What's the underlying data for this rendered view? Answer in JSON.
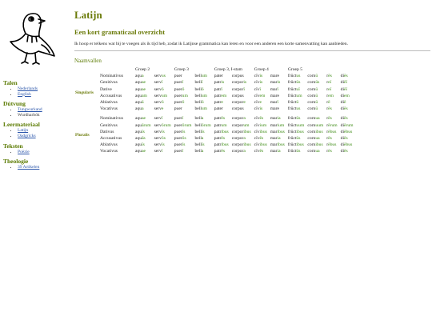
{
  "page": {
    "title": "Latijn",
    "subtitle": "Een kort gramaticaal overzicht",
    "intro": "Ik hoop er telkens wat bij te voegen als ik tijd heb, zodat ik Latijnse grammatica kan leren en voor een anderen een korte samenvatting kan aanbieden.",
    "section": "Naamvallen"
  },
  "sidebar": [
    {
      "title": "Talen",
      "items": [
        {
          "label": "Nederlands",
          "link": true
        },
        {
          "label": "English",
          "link": true
        }
      ]
    },
    {
      "title": "Dútvung",
      "items": [
        {
          "label": "Tungwurkand",
          "link": true
        },
        {
          "label": "Wurdharbók",
          "link": false
        }
      ]
    },
    {
      "title": "Leermateriaal",
      "items": [
        {
          "label": "Latijn",
          "link": true
        },
        {
          "label": "Oadgricks",
          "link": true
        }
      ]
    },
    {
      "title": "Teksten",
      "items": [
        {
          "label": "Poëzie",
          "link": true
        }
      ]
    },
    {
      "title": "Theologie",
      "items": [
        {
          "label": "39 Artikelen",
          "link": true
        }
      ]
    }
  ],
  "table": {
    "groups": [
      "Groep 2",
      "Groep 3",
      "Groep 3, I-stam",
      "Groep 4",
      "Groep 5"
    ],
    "numbers": [
      {
        "label": "Singularis",
        "rows": [
          {
            "case": "Nominativus",
            "forms": [
              [
                "aqu",
                "a"
              ],
              [
                "serv",
                "us"
              ],
              [
                "puer",
                ""
              ],
              [
                "bell",
                "um"
              ],
              [
                "pater",
                ""
              ],
              [
                "corpus",
                ""
              ],
              [
                "cīv",
                "is"
              ],
              [
                "mare",
                ""
              ],
              [
                "frūct",
                "us"
              ],
              [
                "corn",
                "ū"
              ],
              [
                "r",
                "ēs"
              ],
              [
                "di",
                "ēs"
              ]
            ]
          },
          {
            "case": "Genitivus",
            "forms": [
              [
                "aqu",
                "ae"
              ],
              [
                "serv",
                "ī"
              ],
              [
                "puer",
                "ī"
              ],
              [
                "bell",
                "ī"
              ],
              [
                "patr",
                "is"
              ],
              [
                "corpor",
                "is"
              ],
              [
                "cīv",
                "is"
              ],
              [
                "mar",
                "is"
              ],
              [
                "frūct",
                "ūs"
              ],
              [
                "corn",
                "ūs"
              ],
              [
                "r",
                "eī"
              ],
              [
                "di",
                "ēī"
              ]
            ]
          },
          {
            "case": "Dative",
            "forms": [
              [
                "aqu",
                "ae"
              ],
              [
                "serv",
                "ō"
              ],
              [
                "puer",
                "ō"
              ],
              [
                "bell",
                "ō"
              ],
              [
                "patr",
                "ī"
              ],
              [
                "corpor",
                "ī"
              ],
              [
                "cīv",
                "ī"
              ],
              [
                "mar",
                "ī"
              ],
              [
                "frūct",
                "uī"
              ],
              [
                "corn",
                "ū"
              ],
              [
                "r",
                "eī"
              ],
              [
                "di",
                "ēī"
              ]
            ]
          },
          {
            "case": "Accusativus",
            "forms": [
              [
                "aqu",
                "am"
              ],
              [
                "serv",
                "um"
              ],
              [
                "puer",
                "um"
              ],
              [
                "bell",
                "um"
              ],
              [
                "patr",
                "em"
              ],
              [
                "corpus",
                ""
              ],
              [
                "cīv",
                "em"
              ],
              [
                "mare",
                ""
              ],
              [
                "frūct",
                "um"
              ],
              [
                "corn",
                "ū"
              ],
              [
                "r",
                "em"
              ],
              [
                "di",
                "em"
              ]
            ]
          },
          {
            "case": "Ablativus",
            "forms": [
              [
                "aqu",
                "ā"
              ],
              [
                "serv",
                "ō"
              ],
              [
                "puer",
                "ō"
              ],
              [
                "bell",
                "ō"
              ],
              [
                "patr",
                "e"
              ],
              [
                "corpor",
                "e"
              ],
              [
                "cīv",
                "e"
              ],
              [
                "mar",
                "ī"
              ],
              [
                "frūct",
                "ū"
              ],
              [
                "corn",
                "ū"
              ],
              [
                "r",
                "ē"
              ],
              [
                "di",
                "ē"
              ]
            ]
          },
          {
            "case": "Vocativus",
            "forms": [
              [
                "aqu",
                "a"
              ],
              [
                "serv",
                "e"
              ],
              [
                "puer",
                ""
              ],
              [
                "bell",
                "um"
              ],
              [
                "pater",
                ""
              ],
              [
                "corpus",
                ""
              ],
              [
                "cīv",
                "is"
              ],
              [
                "mare",
                ""
              ],
              [
                "frūct",
                "us"
              ],
              [
                "corn",
                "ū"
              ],
              [
                "r",
                "ēs"
              ],
              [
                "di",
                "ēs"
              ]
            ]
          }
        ]
      },
      {
        "label": "Pluralis",
        "rows": [
          {
            "case": "Nominativus",
            "forms": [
              [
                "aqu",
                "ae"
              ],
              [
                "serv",
                "ī"
              ],
              [
                "puer",
                "ī"
              ],
              [
                "bell",
                "a"
              ],
              [
                "patr",
                "ēs"
              ],
              [
                "corpor",
                "a"
              ],
              [
                "cīv",
                "ēs"
              ],
              [
                "mar",
                "ia"
              ],
              [
                "frūct",
                "ūs"
              ],
              [
                "corn",
                "ua"
              ],
              [
                "r",
                "ēs"
              ],
              [
                "di",
                "ēs"
              ]
            ]
          },
          {
            "case": "Genitivus",
            "forms": [
              [
                "aqu",
                "ārum"
              ],
              [
                "serv",
                "ōrum"
              ],
              [
                "puer",
                "ōrum"
              ],
              [
                "bell",
                "ōrum"
              ],
              [
                "patr",
                "um"
              ],
              [
                "corpor",
                "um"
              ],
              [
                "cīv",
                "ium"
              ],
              [
                "mar",
                "ium"
              ],
              [
                "frūct",
                "uum"
              ],
              [
                "corn",
                "uum"
              ],
              [
                "r",
                "ērum"
              ],
              [
                "di",
                "ērum"
              ]
            ]
          },
          {
            "case": "Dativus",
            "forms": [
              [
                "aqu",
                "īs"
              ],
              [
                "serv",
                "īs"
              ],
              [
                "puer",
                "īs"
              ],
              [
                "bell",
                "īs"
              ],
              [
                "patr",
                "ibus"
              ],
              [
                "corpor",
                "ibus"
              ],
              [
                "cīv",
                "ibus"
              ],
              [
                "mar",
                "ibus"
              ],
              [
                "frūct",
                "ibus"
              ],
              [
                "corn",
                "ibus"
              ],
              [
                "r",
                "ēbus"
              ],
              [
                "di",
                "ēbus"
              ]
            ]
          },
          {
            "case": "Accusativus",
            "forms": [
              [
                "aqu",
                "ās"
              ],
              [
                "serv",
                "ōs"
              ],
              [
                "puer",
                "ōs"
              ],
              [
                "bell",
                "a"
              ],
              [
                "patr",
                "ēs"
              ],
              [
                "corpor",
                "a"
              ],
              [
                "cīv",
                "ēs"
              ],
              [
                "mar",
                "ia"
              ],
              [
                "frūct",
                "ūs"
              ],
              [
                "corn",
                "ua"
              ],
              [
                "r",
                "ēs"
              ],
              [
                "di",
                "ēs"
              ]
            ]
          },
          {
            "case": "Ablativus",
            "forms": [
              [
                "aqu",
                "īs"
              ],
              [
                "serv",
                "īs"
              ],
              [
                "puer",
                "īs"
              ],
              [
                "bell",
                "īs"
              ],
              [
                "patr",
                "ibus"
              ],
              [
                "corpor",
                "ibus"
              ],
              [
                "cīv",
                "ibus"
              ],
              [
                "mar",
                "ibus"
              ],
              [
                "frūct",
                "ibus"
              ],
              [
                "corn",
                "ibus"
              ],
              [
                "r",
                "ēbus"
              ],
              [
                "di",
                "ēbus"
              ]
            ]
          },
          {
            "case": "Vocativus",
            "forms": [
              [
                "aqu",
                "ae"
              ],
              [
                "serv",
                "ī"
              ],
              [
                "puer",
                "ī"
              ],
              [
                "bell",
                "a"
              ],
              [
                "patr",
                "ēs"
              ],
              [
                "corpor",
                "a"
              ],
              [
                "cīv",
                "ēs"
              ],
              [
                "mar",
                "ia"
              ],
              [
                "frūct",
                "ūs"
              ],
              [
                "corn",
                "ua"
              ],
              [
                "r",
                "ēs"
              ],
              [
                "di",
                "ēs"
              ]
            ]
          }
        ]
      }
    ]
  },
  "colors": {
    "heading": "#6b7b0a",
    "ending": "#3b8a12",
    "link": "#2a55aa"
  },
  "icons": {
    "logo": "pigeon-logo-icon"
  }
}
